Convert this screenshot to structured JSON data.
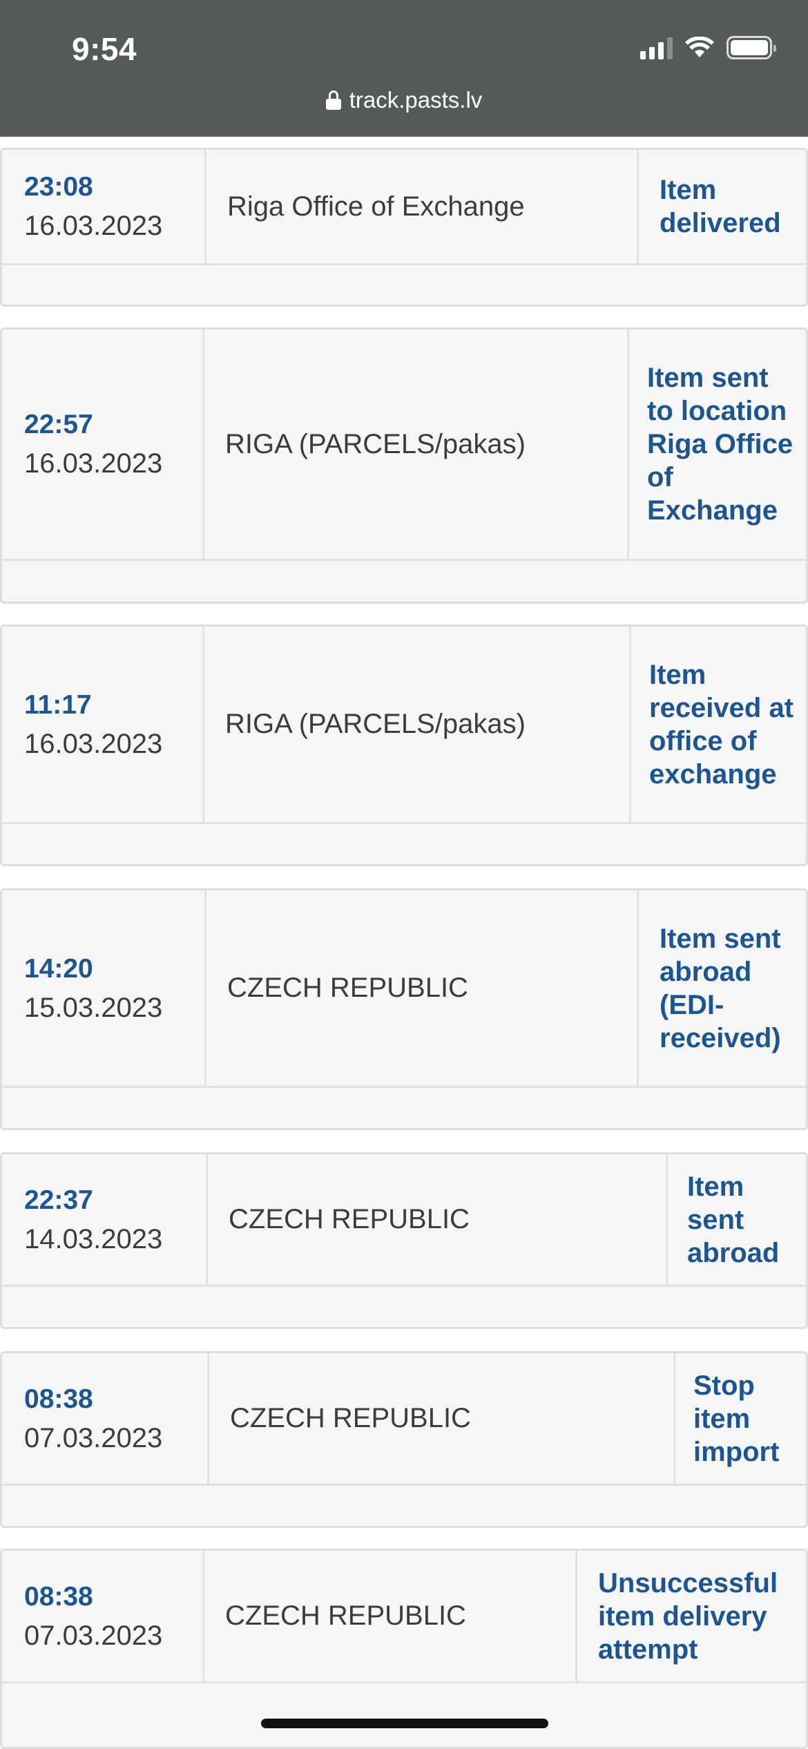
{
  "status_bar": {
    "time": "9:54",
    "url": "track.pasts.lv"
  },
  "events": [
    {
      "time": "23:08",
      "date": "16.03.2023",
      "location": "Riga Office of Exchange",
      "status": "Item delivered"
    },
    {
      "time": "22:57",
      "date": "16.03.2023",
      "location": "RIGA (PARCELS/pakas)",
      "status": "Item sent to location Riga Office of Exchange"
    },
    {
      "time": "11:17",
      "date": "16.03.2023",
      "location": "RIGA (PARCELS/pakas)",
      "status": "Item received at office of exchange"
    },
    {
      "time": "14:20",
      "date": "15.03.2023",
      "location": "CZECH REPUBLIC",
      "status": "Item sent abroad (EDI-received)"
    },
    {
      "time": "22:37",
      "date": "14.03.2023",
      "location": "CZECH REPUBLIC",
      "status": "Item sent abroad"
    },
    {
      "time": "08:38",
      "date": "07.03.2023",
      "location": "CZECH REPUBLIC",
      "status": "Stop item import"
    },
    {
      "time": "08:38",
      "date": "07.03.2023",
      "location": "CZECH REPUBLIC",
      "status": "Unsuccessful item delivery attempt"
    }
  ],
  "colors": {
    "status_bar_bg": "#56595a",
    "accent_blue": "#1d5590",
    "text_gray": "#3c3c3c",
    "card_bg": "#f6f6f6"
  }
}
